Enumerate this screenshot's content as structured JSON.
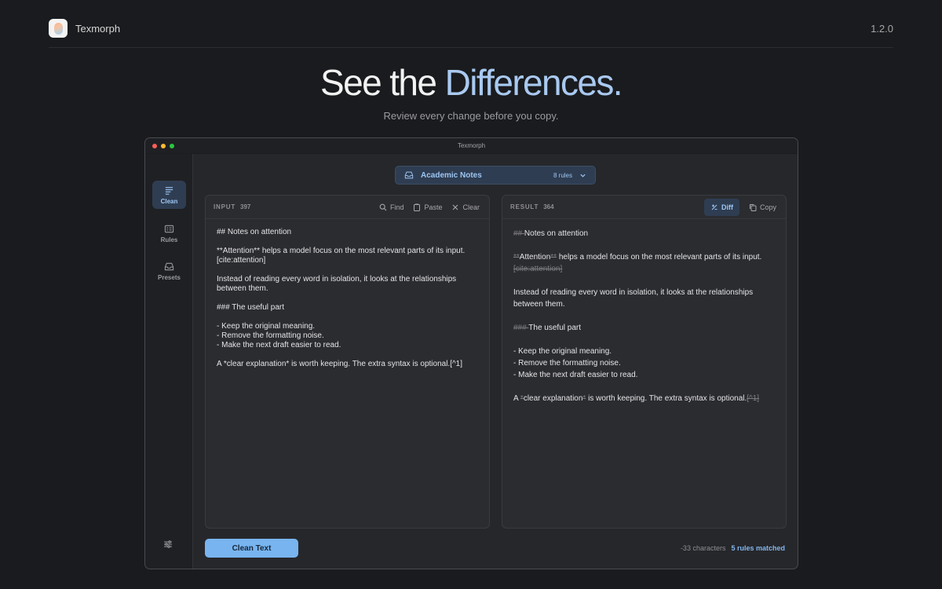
{
  "header": {
    "brand": "Texmorph",
    "version": "1.2.0"
  },
  "hero": {
    "title_plain": "See the ",
    "title_accent": "Differences.",
    "subtitle": "Review every change before you copy."
  },
  "window": {
    "title": "Texmorph",
    "sidebar": [
      {
        "label": "Clean",
        "icon": "text-lines-icon",
        "active": true
      },
      {
        "label": "Rules",
        "icon": "list-card-icon",
        "active": false
      },
      {
        "label": "Presets",
        "icon": "inbox-icon",
        "active": false
      }
    ],
    "preset": {
      "name": "Academic Notes",
      "rules": "8 rules"
    },
    "input": {
      "label": "INPUT",
      "count": "397",
      "tools": {
        "find": "Find",
        "paste": "Paste",
        "clear": "Clear"
      },
      "lines": [
        "## Notes on attention",
        "**Attention** helps a model focus on the most relevant parts of its input.\n[cite:attention]",
        "Instead of reading every word in isolation, it looks at the relationships\nbetween them.",
        "### The useful part",
        "- Keep the original meaning.\n- Remove the formatting noise.\n- Make the next draft easier to read.",
        "A *clear explanation* is worth keeping. The extra syntax is optional.[^1]"
      ]
    },
    "result": {
      "label": "RESULT",
      "count": "364",
      "tools": {
        "diff": "Diff",
        "copy": "Copy"
      },
      "r1_del": "## ",
      "r1_keep": "Notes on attention",
      "r2_del_a": "**",
      "r2_keep_a": "Attention",
      "r2_del_b": "**",
      "r2_keep_b": " helps a model focus on the most relevant parts of its input.",
      "r2_del_c": "[cite:attention]",
      "r3": "Instead of reading every word in isolation, it looks at the relationships between them.",
      "r4_del": "### ",
      "r4_keep": "The useful part",
      "r5": "- Keep the original meaning.\n- Remove the formatting noise.\n- Make the next draft easier to read.",
      "r6_keep_a": "A ",
      "r6_del_a": "*",
      "r6_keep_b": "clear explanation",
      "r6_del_b": "*",
      "r6_keep_c": " is worth keeping. The extra syntax is optional.",
      "r6_del_c": "[^1]"
    },
    "footer": {
      "button": "Clean Text",
      "chars": "-33 characters",
      "matched": "5 rules matched"
    }
  }
}
